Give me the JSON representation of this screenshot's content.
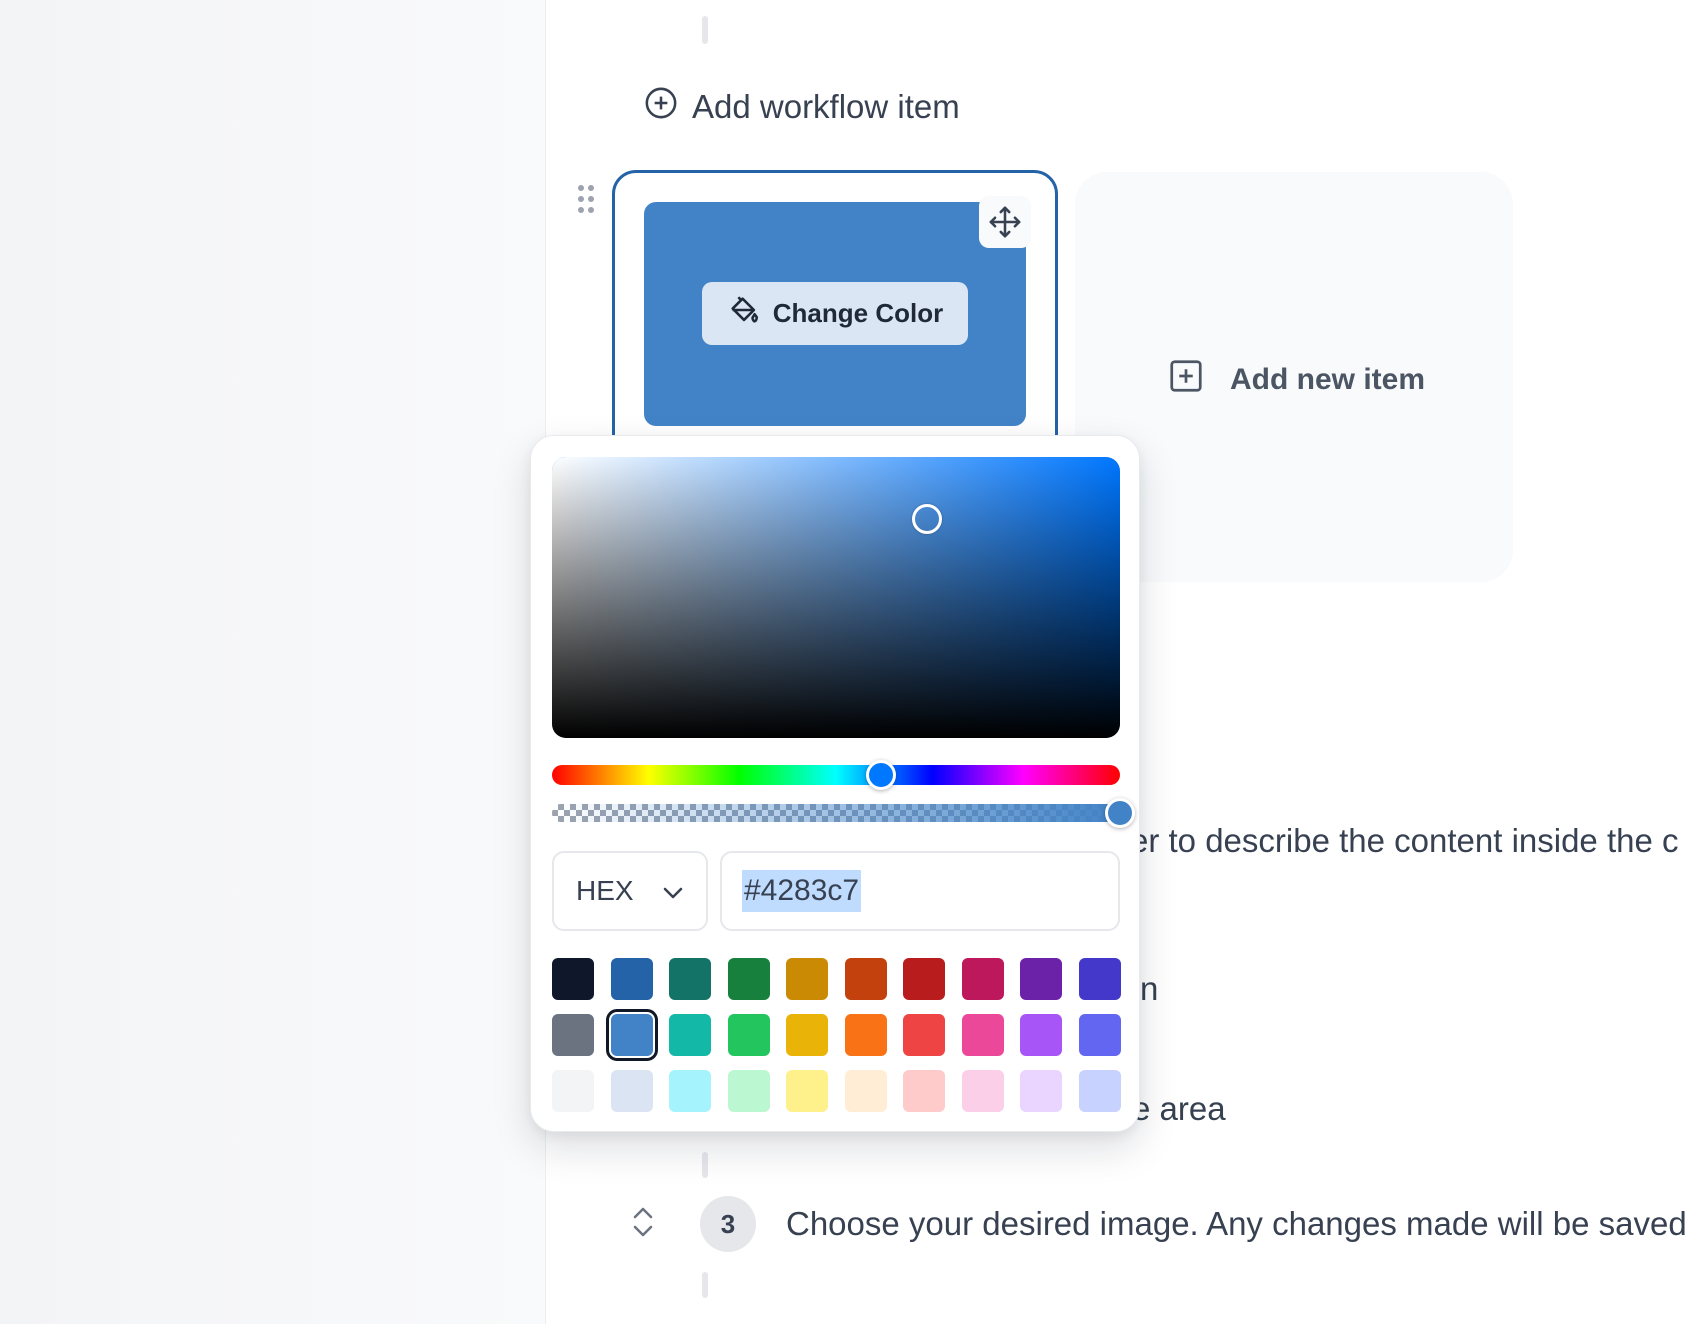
{
  "workflow": {
    "add_label": "Add workflow item"
  },
  "card": {
    "image_color": "#4283c7",
    "change_color_label": "Change Color"
  },
  "new_item": {
    "label": "Add new item"
  },
  "background_text": {
    "line1": "er to describe the content inside the c",
    "line2": "n",
    "line3": "e area"
  },
  "step": {
    "number": "3",
    "text": "Choose your desired image. Any changes made will be saved"
  },
  "picker": {
    "hue_color": "#0077ff",
    "hue_fraction": 0.58,
    "alpha_fraction": 1.0,
    "sv_saturation": 0.66,
    "sv_value": 0.78,
    "format_label": "HEX",
    "hex_value": "#4283c7",
    "swatches": [
      [
        "#0f172a",
        "#2563a8",
        "#137366",
        "#17803d",
        "#ca8a04",
        "#c2410c",
        "#b91c1c",
        "#be185d",
        "#6b21a8",
        "#4338ca"
      ],
      [
        "#6b7280",
        "#4283c7",
        "#14b8a6",
        "#22c55e",
        "#eab308",
        "#f97316",
        "#ef4444",
        "#ec4899",
        "#a855f7",
        "#6366f1"
      ],
      [
        "#f3f4f6",
        "#dbe4f2",
        "#a5f3fc",
        "#bbf7d0",
        "#fef08a",
        "#ffedd5",
        "#fecaca",
        "#fbcfe8",
        "#e9d5ff",
        "#c7d2fe"
      ]
    ],
    "selected_swatch": "#4283c7"
  }
}
